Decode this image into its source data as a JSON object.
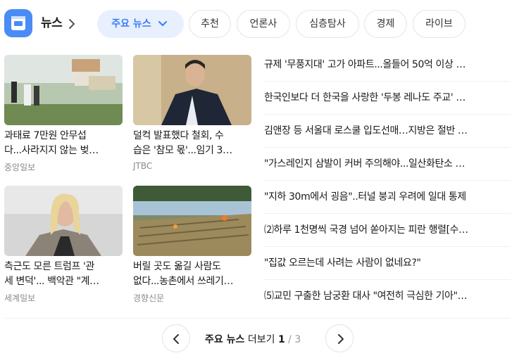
{
  "header": {
    "title": "뉴스",
    "icon": "news-app-icon",
    "accent": "#3b7cf4"
  },
  "tabs": [
    {
      "label": "주요 뉴스",
      "active": true
    },
    {
      "label": "추천"
    },
    {
      "label": "언론사"
    },
    {
      "label": "심층탐사"
    },
    {
      "label": "경제"
    },
    {
      "label": "라이브"
    }
  ],
  "cards": [
    {
      "title1": "과태료 7만원 안무섭",
      "title2": "다...사라지지 않는 벚…",
      "source": "중앙일보"
    },
    {
      "title1": "덜컥 발표했다 철회, 수",
      "title2": "습은 '참모 몫'...임기 3…",
      "source": "JTBC"
    },
    {
      "title1": "측근도 모른 트럼프 '관",
      "title2": "세 변덕'... 백악관 \"계…",
      "source": "세계일보"
    },
    {
      "title1": "버릴 곳도 옮길 사람도",
      "title2": "없다...농촌에서 쓰레기…",
      "source": "경향신문"
    }
  ],
  "headlines": [
    "규제 '무풍지대' 고가 아파트...올들어 50억 이상 …",
    "한국인보다 더 한국을 사랑한 '두봉 레나도 주교' …",
    "김앤장 등 서울대 로스쿨 입도선매…지방은 절반 …",
    "\"가스레인지 삼발이 커버 주의해야...일산화탄소 …",
    "\"지하 30m에서 굉음\"..터널 붕괴 우려에 일대 통제",
    "⑵하루 1천명씩 국경 넘어 쏟아지는 피란 행렬[수…",
    "\"집값 오르는데 사려는 사람이 없네요?\"",
    "⑸교민 구출한 남궁환 대사 \"여전히 극심한 기아\"…"
  ],
  "pagination": {
    "label_bold": "주요 뉴스",
    "label_rest": " 더보기 ",
    "current": "1",
    "separator": " / ",
    "total": "3"
  }
}
